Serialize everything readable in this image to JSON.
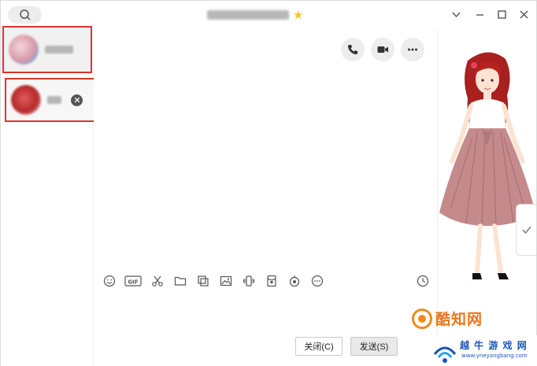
{
  "window": {
    "title": "████ ██ ████",
    "star": "★"
  },
  "titlebar": {
    "search_icon": "search-icon",
    "minimize_icon": "minimize-icon",
    "maximize_icon": "maximize-icon",
    "close_icon": "close-icon",
    "dropdown_icon": "chevron-down-icon"
  },
  "contacts": [
    {
      "name": "██████",
      "avatar": "blurred",
      "selected": true
    },
    {
      "name": "███",
      "avatar": "blurred",
      "selected": true
    }
  ],
  "chat": {
    "toolbar_icons": [
      "emoji-icon",
      "gif-icon",
      "scissors-icon",
      "folder-icon",
      "picture-edit-icon",
      "image-icon",
      "shake-icon",
      "red-packet-icon",
      "voice-icon",
      "more-icon",
      "history-icon"
    ],
    "gif_label": "GIF",
    "close_button": "关闭(C)",
    "send_button": "发送(S)"
  },
  "watermarks": {
    "brand1": "酷知网",
    "brand2": "越 牛 游 戏 网",
    "brand2_url": "www.yneyangbang.com"
  },
  "colors": {
    "accent_red": "#d9362c",
    "watermark_orange": "#e8771a",
    "watermark_blue": "#1a56b8"
  }
}
